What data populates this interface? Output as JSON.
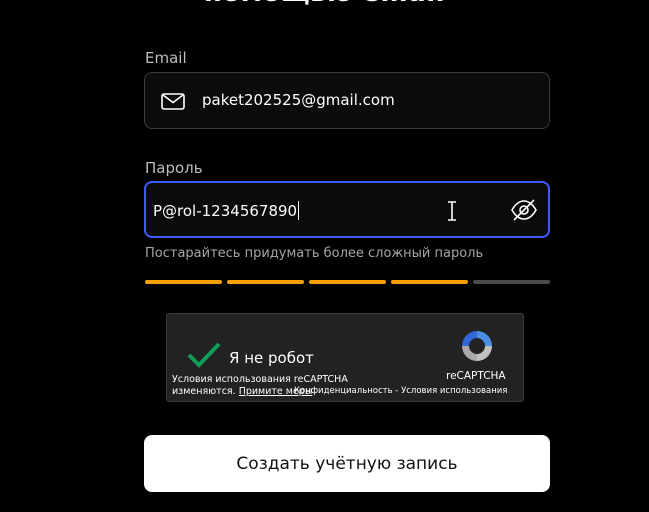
{
  "heading": "помощью email",
  "email": {
    "label": "Email",
    "value": "paket202525@gmail.com",
    "icon": "mail-icon"
  },
  "password": {
    "label": "Пароль",
    "value": "P@rol-1234567890",
    "visibility_icon": "eye-slash-icon"
  },
  "strength": {
    "hint": "Постарайтесь придумать более сложный пароль",
    "filled_segments": 4,
    "total_segments": 5,
    "color": "#f5a000"
  },
  "captcha": {
    "label": "Я не робот",
    "terms_line1": "Условия использования reCAPTCHA",
    "terms_line2": "изменяются.",
    "terms_link": "Примите меры",
    "brand": "reCAPTCHA",
    "links": "Конфиденциальность - Условия использования",
    "checked": true
  },
  "submit": {
    "label": "Создать учётную запись"
  },
  "colors": {
    "focus": "#3d5afe",
    "check": "#0f9d58"
  }
}
